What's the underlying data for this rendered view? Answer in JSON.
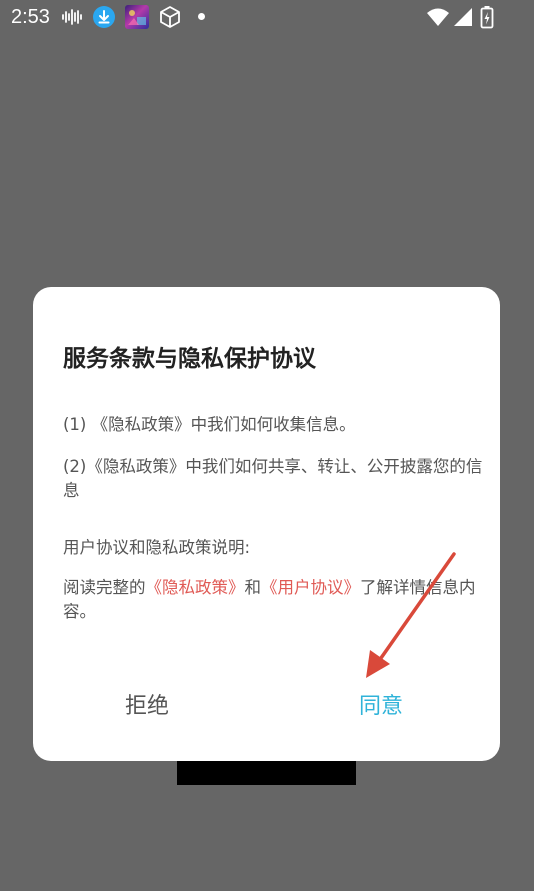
{
  "status_bar": {
    "time": "2:53",
    "icons": [
      "audio-wave-icon",
      "download-icon",
      "app-icon",
      "cube-icon",
      "dot-icon",
      "wifi-icon",
      "signal-icon",
      "battery-icon"
    ]
  },
  "dialog": {
    "title": "服务条款与隐私保护协议",
    "item_1": "(1) 《隐私政策》中我们如何收集信息。",
    "item_2": "(2)《隐私政策》中我们如何共享、转让、公开披露您的信息",
    "explain_title": "用户协议和隐私政策说明:",
    "explain_prefix": "阅读完整的",
    "privacy_link": "《隐私政策》",
    "explain_and": "和",
    "user_link": "《用户协议》",
    "explain_suffix": "了解详情信息内容。",
    "reject_label": "拒绝",
    "agree_label": "同意"
  },
  "colors": {
    "background": "#666666",
    "dialog": "#ffffff",
    "title": "#222222",
    "body_text": "#555555",
    "link": "#e05a55",
    "agree": "#2fb3d9",
    "annotation_arrow": "#d9493a"
  }
}
